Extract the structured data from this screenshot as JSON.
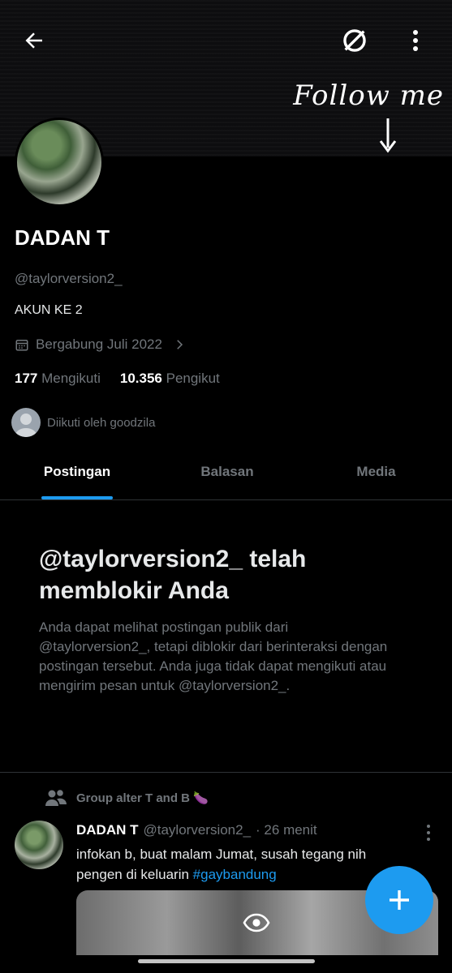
{
  "banner": {
    "text": "Follow me"
  },
  "header": {
    "back_icon": "arrow-left-icon",
    "grok_icon": "slashed-circle-icon",
    "more_icon": "more-vertical-icon"
  },
  "profile": {
    "name": "DADAN T",
    "handle": "@taylorversion2_",
    "bio": "AKUN KE 2",
    "joined": "Bergabung Juli 2022",
    "following_count": "177",
    "following_label": "Mengikuti",
    "followers_count": "10.356",
    "followers_label": "Pengikut",
    "followed_by": "Diikuti oleh goodzila"
  },
  "tabs": [
    {
      "label": "Postingan",
      "active": true
    },
    {
      "label": "Balasan",
      "active": false
    },
    {
      "label": "Media",
      "active": false
    }
  ],
  "blocked": {
    "title": "@taylorversion2_ telah memblokir Anda",
    "description": "Anda dapat melihat postingan publik dari @taylorversion2_, tetapi diblokir dari berinteraksi dengan postingan tersebut. Anda juga tidak dapat mengikuti atau mengirim pesan untuk @taylorversion2_."
  },
  "post": {
    "group_label": "Group alter T and B 🍆",
    "author_name": "DADAN T",
    "author_handle": "@taylorversion2_",
    "time": "· 26 menit",
    "text_before": "infokan b, buat malam Jumat, susah tegang nih pengen di keluarin ",
    "hashtag": "#gaybandung"
  },
  "colors": {
    "accent": "#1d9bf0",
    "muted": "#71767b",
    "background": "#000000"
  }
}
